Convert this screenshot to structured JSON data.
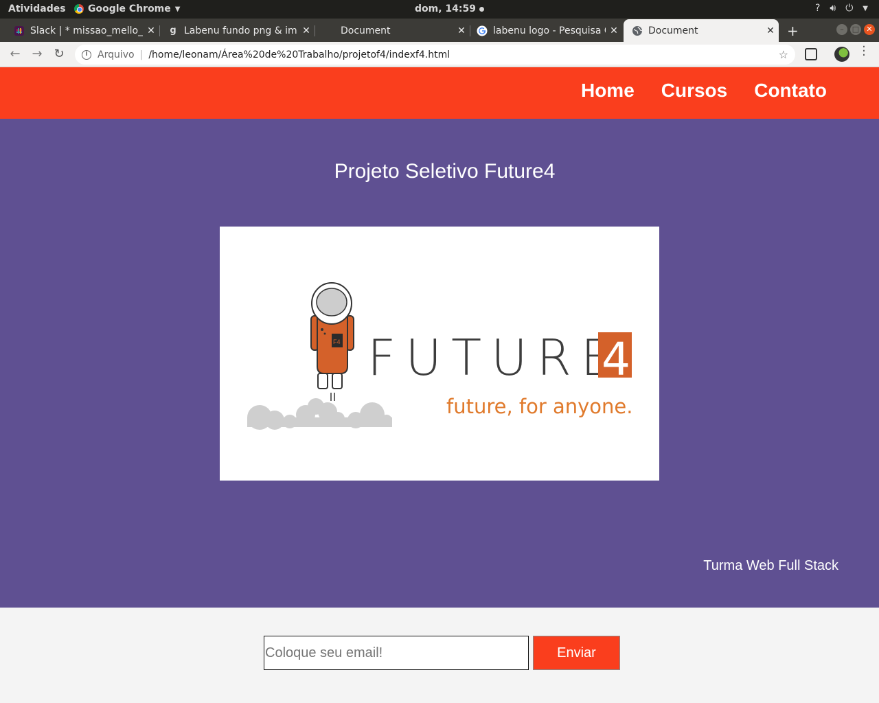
{
  "os_bar": {
    "activities": "Atividades",
    "app_name": "Google Chrome",
    "clock": "dom, 14:59"
  },
  "tabs": [
    {
      "title": "Slack | * missao_mello_c",
      "favicon": "slack-icon",
      "active": false
    },
    {
      "title": "Labenu fundo png & im",
      "favicon": "g-letter-icon",
      "active": false
    },
    {
      "title": "Document",
      "favicon": "blank-icon",
      "active": false
    },
    {
      "title": "labenu logo - Pesquisa G",
      "favicon": "google-icon",
      "active": false
    },
    {
      "title": "Document",
      "favicon": "globe-icon",
      "active": true
    }
  ],
  "address_bar": {
    "scheme_label": "Arquivo",
    "url": "/home/leonam/Área%20de%20Trabalho/projetof4/indexf4.html"
  },
  "site": {
    "nav": [
      "Home",
      "Cursos",
      "Contato"
    ],
    "title": "Projeto Seletivo Future4",
    "logo": {
      "wordmark": "FUTURE",
      "wordmark_digit": "4",
      "tagline": "future, for anyone.",
      "badge": "F4"
    },
    "turma": "Turma Web Full Stack",
    "email_placeholder": "Coloque seu email!",
    "send_label": "Enviar"
  },
  "colors": {
    "header": "#fa3e1d",
    "hero": "#5f5092",
    "logo_orange": "#d4612a",
    "wordmark_gray": "#3d3d3d"
  }
}
